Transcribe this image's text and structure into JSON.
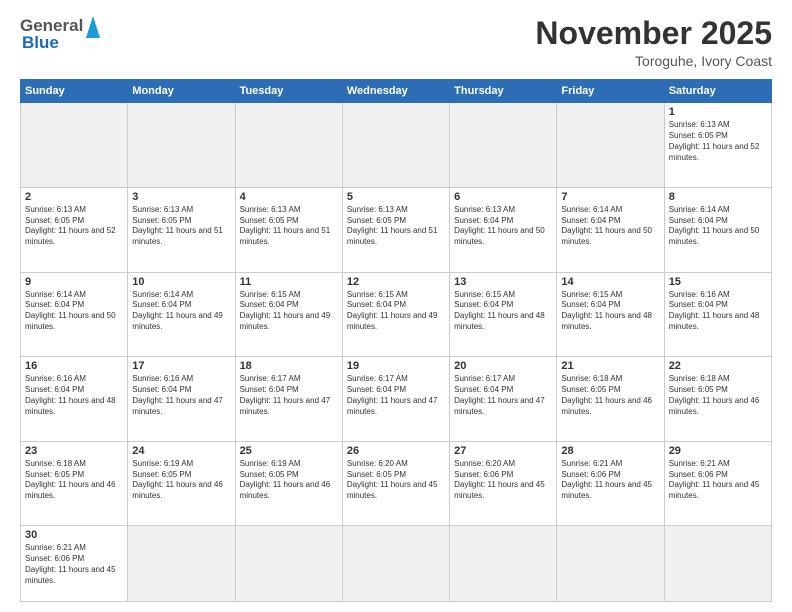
{
  "header": {
    "logo_general": "General",
    "logo_blue": "Blue",
    "month_title": "November 2025",
    "location": "Toroguhe, Ivory Coast"
  },
  "days_of_week": [
    "Sunday",
    "Monday",
    "Tuesday",
    "Wednesday",
    "Thursday",
    "Friday",
    "Saturday"
  ],
  "weeks": [
    [
      {
        "day": "",
        "info": ""
      },
      {
        "day": "",
        "info": ""
      },
      {
        "day": "",
        "info": ""
      },
      {
        "day": "",
        "info": ""
      },
      {
        "day": "",
        "info": ""
      },
      {
        "day": "",
        "info": ""
      },
      {
        "day": "1",
        "info": "Sunrise: 6:13 AM\nSunset: 6:05 PM\nDaylight: 11 hours and 52 minutes."
      }
    ],
    [
      {
        "day": "2",
        "info": "Sunrise: 6:13 AM\nSunset: 6:05 PM\nDaylight: 11 hours and 52 minutes."
      },
      {
        "day": "3",
        "info": "Sunrise: 6:13 AM\nSunset: 6:05 PM\nDaylight: 11 hours and 51 minutes."
      },
      {
        "day": "4",
        "info": "Sunrise: 6:13 AM\nSunset: 6:05 PM\nDaylight: 11 hours and 51 minutes."
      },
      {
        "day": "5",
        "info": "Sunrise: 6:13 AM\nSunset: 6:05 PM\nDaylight: 11 hours and 51 minutes."
      },
      {
        "day": "6",
        "info": "Sunrise: 6:13 AM\nSunset: 6:04 PM\nDaylight: 11 hours and 50 minutes."
      },
      {
        "day": "7",
        "info": "Sunrise: 6:14 AM\nSunset: 6:04 PM\nDaylight: 11 hours and 50 minutes."
      },
      {
        "day": "8",
        "info": "Sunrise: 6:14 AM\nSunset: 6:04 PM\nDaylight: 11 hours and 50 minutes."
      }
    ],
    [
      {
        "day": "9",
        "info": "Sunrise: 6:14 AM\nSunset: 6:04 PM\nDaylight: 11 hours and 50 minutes."
      },
      {
        "day": "10",
        "info": "Sunrise: 6:14 AM\nSunset: 6:04 PM\nDaylight: 11 hours and 49 minutes."
      },
      {
        "day": "11",
        "info": "Sunrise: 6:15 AM\nSunset: 6:04 PM\nDaylight: 11 hours and 49 minutes."
      },
      {
        "day": "12",
        "info": "Sunrise: 6:15 AM\nSunset: 6:04 PM\nDaylight: 11 hours and 49 minutes."
      },
      {
        "day": "13",
        "info": "Sunrise: 6:15 AM\nSunset: 6:04 PM\nDaylight: 11 hours and 48 minutes."
      },
      {
        "day": "14",
        "info": "Sunrise: 6:15 AM\nSunset: 6:04 PM\nDaylight: 11 hours and 48 minutes."
      },
      {
        "day": "15",
        "info": "Sunrise: 6:16 AM\nSunset: 6:04 PM\nDaylight: 11 hours and 48 minutes."
      }
    ],
    [
      {
        "day": "16",
        "info": "Sunrise: 6:16 AM\nSunset: 6:04 PM\nDaylight: 11 hours and 48 minutes."
      },
      {
        "day": "17",
        "info": "Sunrise: 6:16 AM\nSunset: 6:04 PM\nDaylight: 11 hours and 47 minutes."
      },
      {
        "day": "18",
        "info": "Sunrise: 6:17 AM\nSunset: 6:04 PM\nDaylight: 11 hours and 47 minutes."
      },
      {
        "day": "19",
        "info": "Sunrise: 6:17 AM\nSunset: 6:04 PM\nDaylight: 11 hours and 47 minutes."
      },
      {
        "day": "20",
        "info": "Sunrise: 6:17 AM\nSunset: 6:04 PM\nDaylight: 11 hours and 47 minutes."
      },
      {
        "day": "21",
        "info": "Sunrise: 6:18 AM\nSunset: 6:05 PM\nDaylight: 11 hours and 46 minutes."
      },
      {
        "day": "22",
        "info": "Sunrise: 6:18 AM\nSunset: 6:05 PM\nDaylight: 11 hours and 46 minutes."
      }
    ],
    [
      {
        "day": "23",
        "info": "Sunrise: 6:18 AM\nSunset: 6:05 PM\nDaylight: 11 hours and 46 minutes."
      },
      {
        "day": "24",
        "info": "Sunrise: 6:19 AM\nSunset: 6:05 PM\nDaylight: 11 hours and 46 minutes."
      },
      {
        "day": "25",
        "info": "Sunrise: 6:19 AM\nSunset: 6:05 PM\nDaylight: 11 hours and 46 minutes."
      },
      {
        "day": "26",
        "info": "Sunrise: 6:20 AM\nSunset: 6:05 PM\nDaylight: 11 hours and 45 minutes."
      },
      {
        "day": "27",
        "info": "Sunrise: 6:20 AM\nSunset: 6:06 PM\nDaylight: 11 hours and 45 minutes."
      },
      {
        "day": "28",
        "info": "Sunrise: 6:21 AM\nSunset: 6:06 PM\nDaylight: 11 hours and 45 minutes."
      },
      {
        "day": "29",
        "info": "Sunrise: 6:21 AM\nSunset: 6:06 PM\nDaylight: 11 hours and 45 minutes."
      }
    ],
    [
      {
        "day": "30",
        "info": "Sunrise: 6:21 AM\nSunset: 6:06 PM\nDaylight: 11 hours and 45 minutes."
      },
      {
        "day": "",
        "info": ""
      },
      {
        "day": "",
        "info": ""
      },
      {
        "day": "",
        "info": ""
      },
      {
        "day": "",
        "info": ""
      },
      {
        "day": "",
        "info": ""
      },
      {
        "day": "",
        "info": ""
      }
    ]
  ]
}
